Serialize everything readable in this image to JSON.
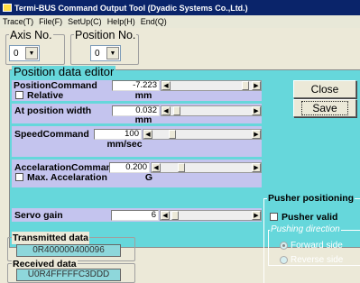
{
  "window": {
    "title": "Termi-BUS Command Output Tool (Dyadic Systems Co.,Ltd.)"
  },
  "menu": {
    "items": [
      "Trace(T)",
      "File(F)",
      "SetUp(C)",
      "Help(H)",
      "End(Q)"
    ]
  },
  "axis": {
    "label": "Axis No.",
    "value": "0"
  },
  "position": {
    "label": "Position No.",
    "value": "0"
  },
  "editor": {
    "title": "Position data editor",
    "position_command": {
      "label": "PositionCommand",
      "value": "-7.223",
      "unit": "mm"
    },
    "relative": {
      "label": "Relative",
      "checked": false
    },
    "at_position_width": {
      "label": "At position width",
      "value": "0.032",
      "unit": "mm"
    },
    "speed_command": {
      "label": "SpeedCommand",
      "value": "100",
      "unit": "mm/sec"
    },
    "accel_command": {
      "label": "AccelarationCommand",
      "value": "0.200",
      "unit": "G"
    },
    "max_accel": {
      "label": "Max. Accelaration",
      "checked": false
    },
    "servo_gain": {
      "label": "Servo gain",
      "value": "6"
    },
    "slider_levels": {
      "position": 0.96,
      "width": 0.04,
      "speed": 0.18,
      "accel": 0.2,
      "servo": 0.02
    }
  },
  "buttons": {
    "close": "Close",
    "save": "Save"
  },
  "pusher": {
    "title": "Pusher positioning",
    "valid_label": "Pusher valid",
    "direction_title": "Pushing direction",
    "forward_label": "Forward side",
    "reverse_label": "Reverse side"
  },
  "transmitted": {
    "label": "Transmitted data",
    "value": "0R400000400096"
  },
  "received": {
    "label": "Received data",
    "value": "U0R4FFFFFC3DDD"
  },
  "colors": {
    "panel": "#66d7db",
    "band": "#c4c4ee",
    "data_box": "#8ed7db",
    "titlebar": "#0a246a"
  },
  "icons": [
    "app-icon",
    "dropdown-arrow-icon",
    "scroll-left-icon",
    "scroll-right-icon"
  ]
}
